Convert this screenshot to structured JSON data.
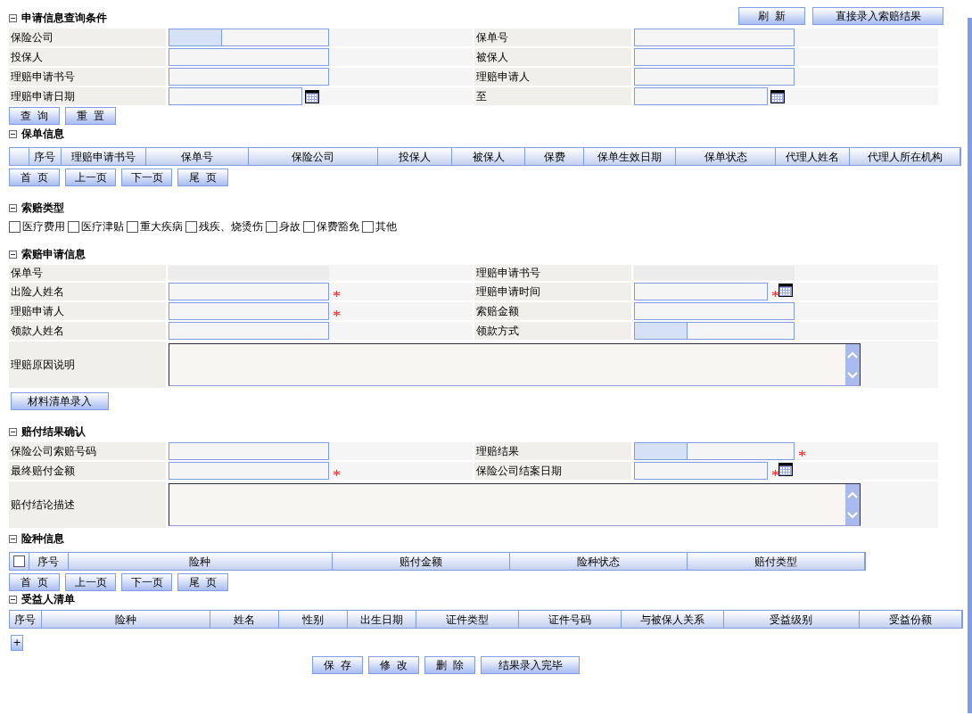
{
  "top_buttons": [
    "刷  新",
    "直接录入索赔结果"
  ],
  "query": {
    "title": "申请信息查询条件",
    "rows": [
      [
        {
          "label": "保险公司",
          "kind": "select",
          "required": false
        },
        {
          "label": "保单号",
          "kind": "text",
          "required": false
        }
      ],
      [
        {
          "label": "投保人",
          "kind": "text",
          "required": false
        },
        {
          "label": "被保人",
          "kind": "text",
          "required": false
        }
      ],
      [
        {
          "label": "理赔申请书号",
          "kind": "text",
          "required": false
        },
        {
          "label": "理赔申请人",
          "kind": "text",
          "required": false
        }
      ],
      [
        {
          "label": "理赔申请日期",
          "kind": "date",
          "required": false
        },
        {
          "label": "至",
          "kind": "date",
          "required": false
        }
      ]
    ],
    "buttons": [
      "查  询",
      "重  置"
    ]
  },
  "policy": {
    "title": "保单信息",
    "select_column": true,
    "columns": [
      "序号",
      "理赔申请书号",
      "保单号",
      "保险公司",
      "投保人",
      "被保人",
      "保费",
      "保单生效日期",
      "保单状态",
      "代理人姓名",
      "代理人所在机构"
    ],
    "pager": [
      "首  页",
      "上一页",
      "下一页",
      "尾  页"
    ]
  },
  "claim_types": {
    "title": "索赔类型",
    "options": [
      {
        "label": "医疗费用",
        "checked": false
      },
      {
        "label": "医疗津贴",
        "checked": false
      },
      {
        "label": "重大疾病",
        "checked": false
      },
      {
        "label": "残疾、烧烫伤",
        "checked": false
      },
      {
        "label": "身故",
        "checked": false
      },
      {
        "label": "保费豁免",
        "checked": false
      },
      {
        "label": "其他",
        "checked": false
      }
    ]
  },
  "application": {
    "title": "索赔申请信息",
    "rows": [
      [
        {
          "label": "保单号",
          "kind": "readonly",
          "required": false
        },
        {
          "label": "理赔申请书号",
          "kind": "readonly",
          "required": false
        }
      ],
      [
        {
          "label": "出险人姓名",
          "kind": "text",
          "required": true
        },
        {
          "label": "理赔申请时间",
          "kind": "date",
          "required": true
        }
      ],
      [
        {
          "label": "理赔申请人",
          "kind": "text",
          "required": true
        },
        {
          "label": "索赔金额",
          "kind": "text",
          "required": false
        }
      ],
      [
        {
          "label": "领款人姓名",
          "kind": "text",
          "required": false
        },
        {
          "label": "领款方式",
          "kind": "select",
          "required": false
        }
      ],
      [
        {
          "label": "理赔原因说明",
          "kind": "textarea"
        }
      ]
    ],
    "buttons": [
      "材料清单录入"
    ]
  },
  "result": {
    "title": "赔付结果确认",
    "rows": [
      [
        {
          "label": "保险公司索赔号码",
          "kind": "text",
          "required": false
        },
        {
          "label": "理赔结果",
          "kind": "select",
          "required": true
        }
      ],
      [
        {
          "label": "最终赔付金额",
          "kind": "text",
          "required": true
        },
        {
          "label": "保险公司结案日期",
          "kind": "date",
          "required": true
        }
      ],
      [
        {
          "label": "赔付结论描述",
          "kind": "textarea"
        }
      ]
    ]
  },
  "coverage": {
    "title": "险种信息",
    "select_all": {
      "checked": false
    },
    "columns": [
      "序号",
      "险种",
      "赔付金额",
      "险种状态",
      "赔付类型"
    ],
    "pager": [
      "首  页",
      "上一页",
      "下一页",
      "尾  页"
    ]
  },
  "beneficiaries": {
    "title": "受益人清单",
    "columns": [
      "序号",
      "险种",
      "姓名",
      "性别",
      "出生日期",
      "证件类型",
      "证件号码",
      "与被保人关系",
      "受益级别",
      "受益份额"
    ],
    "add_button": "+"
  },
  "bottom_buttons": [
    "保  存",
    "修  改",
    "删  除",
    "结果录入完毕"
  ]
}
